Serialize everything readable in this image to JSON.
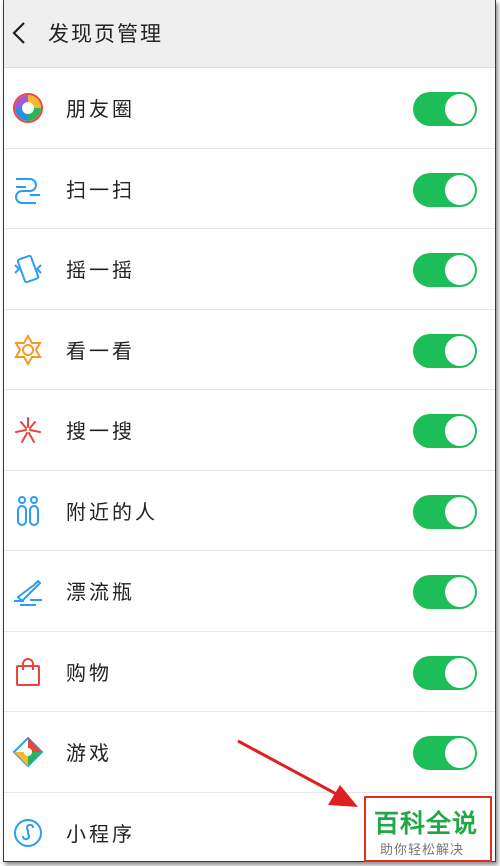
{
  "header": {
    "title": "发现页管理",
    "back_icon": "chevron-left-icon"
  },
  "items": [
    {
      "label": "朋友圈",
      "icon": "moments-icon",
      "on": true
    },
    {
      "label": "扫一扫",
      "icon": "scan-icon",
      "on": true
    },
    {
      "label": "摇一摇",
      "icon": "shake-icon",
      "on": true
    },
    {
      "label": "看一看",
      "icon": "top-stories-icon",
      "on": true
    },
    {
      "label": "搜一搜",
      "icon": "search-icon",
      "on": true
    },
    {
      "label": "附近的人",
      "icon": "people-nearby-icon",
      "on": true
    },
    {
      "label": "漂流瓶",
      "icon": "drift-bottle-icon",
      "on": true
    },
    {
      "label": "购物",
      "icon": "shopping-bag-icon",
      "on": true
    },
    {
      "label": "游戏",
      "icon": "games-icon",
      "on": true
    },
    {
      "label": "小程序",
      "icon": "mini-program-icon"
    }
  ],
  "colors": {
    "toggle_on": "#1dbe5a",
    "header_bg": "#efefef",
    "annotation_arrow": "#e02020"
  },
  "watermark": {
    "main": "百科全说",
    "sub": "助你轻松解决"
  }
}
